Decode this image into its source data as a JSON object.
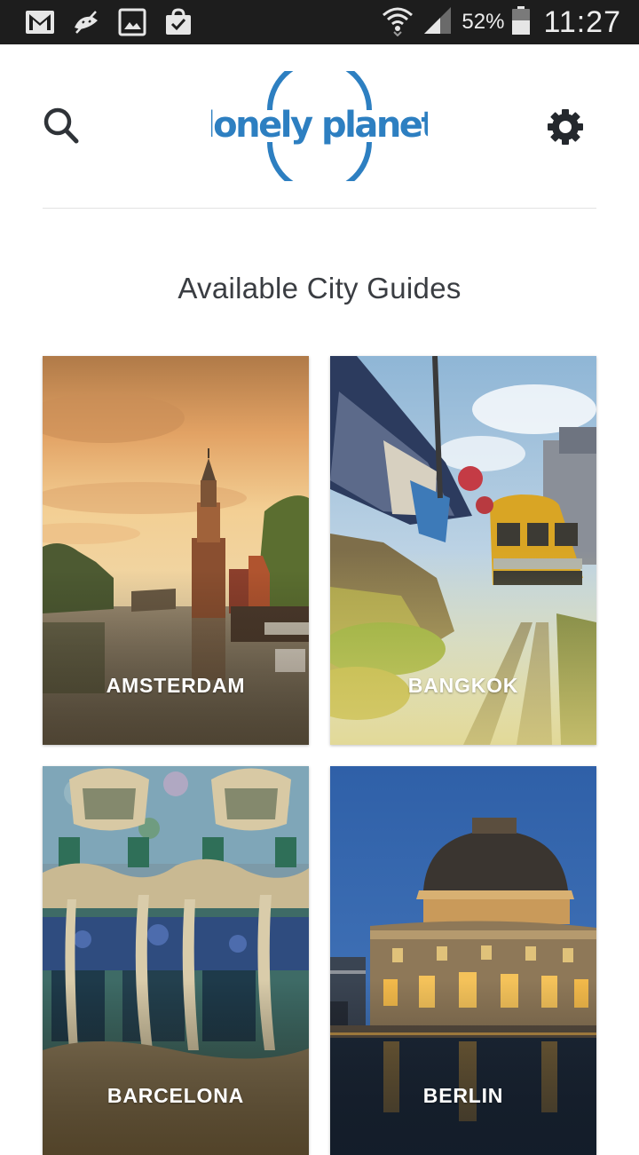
{
  "status_bar": {
    "battery_percent": "52%",
    "time": "11:27",
    "icons": [
      "gmail-icon",
      "android-debug-icon",
      "gallery-icon",
      "store-icon",
      "wifi-icon",
      "signal-icon",
      "battery-icon"
    ]
  },
  "header": {
    "logo_text": "lonely planet",
    "brand_color": "#2d7fc1",
    "icons": [
      "search-icon",
      "settings-gear-icon"
    ]
  },
  "main": {
    "title": "Available City Guides",
    "cities": [
      {
        "name": "AMSTERDAM"
      },
      {
        "name": "BANGKOK"
      },
      {
        "name": "BARCELONA"
      },
      {
        "name": "BERLIN"
      }
    ]
  }
}
